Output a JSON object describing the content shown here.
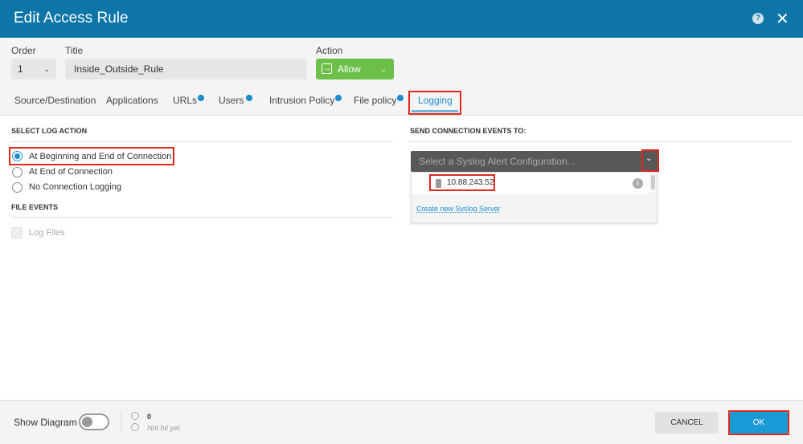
{
  "header": {
    "title": "Edit Access Rule",
    "help_icon": "question-icon",
    "close_icon": "close-icon"
  },
  "form": {
    "order_label": "Order",
    "order_value": "1",
    "title_label": "Title",
    "title_value": "Inside_Outside_Rule",
    "action_label": "Action",
    "action_value": "Allow"
  },
  "tabs": [
    {
      "label": "Source/Destination"
    },
    {
      "label": "Applications"
    },
    {
      "label": "URLs",
      "info": true
    },
    {
      "label": "Users",
      "info": true
    },
    {
      "label": "Intrusion Policy",
      "info": true
    },
    {
      "label": "File policy",
      "info": true
    },
    {
      "label": "Logging",
      "active": true
    }
  ],
  "logging": {
    "log_action_heading": "SELECT LOG ACTION",
    "options": [
      {
        "label": "At Beginning and End of Connection",
        "selected": true
      },
      {
        "label": "At End of Connection",
        "selected": false
      },
      {
        "label": "No Connection Logging",
        "selected": false
      }
    ],
    "file_events_heading": "FILE EVENTS",
    "log_files_label": "Log Files",
    "log_files_checked": false
  },
  "send_events": {
    "heading": "SEND CONNECTION EVENTS TO:",
    "placeholder": "Select a Syslog Alert Configuration...",
    "options": [
      "10.88.243.52"
    ],
    "create_link": "Create new Syslog Server"
  },
  "footer": {
    "show_diagram_label": "Show Diagram",
    "show_diagram_on": false,
    "hit_count": "0",
    "hit_status": "Not hit yet",
    "cancel_label": "CANCEL",
    "ok_label": "OK"
  },
  "colors": {
    "header": "#0d75a8",
    "accent": "#1a8ccf",
    "allow": "#6cc04a",
    "highlight": "#e0281b"
  }
}
